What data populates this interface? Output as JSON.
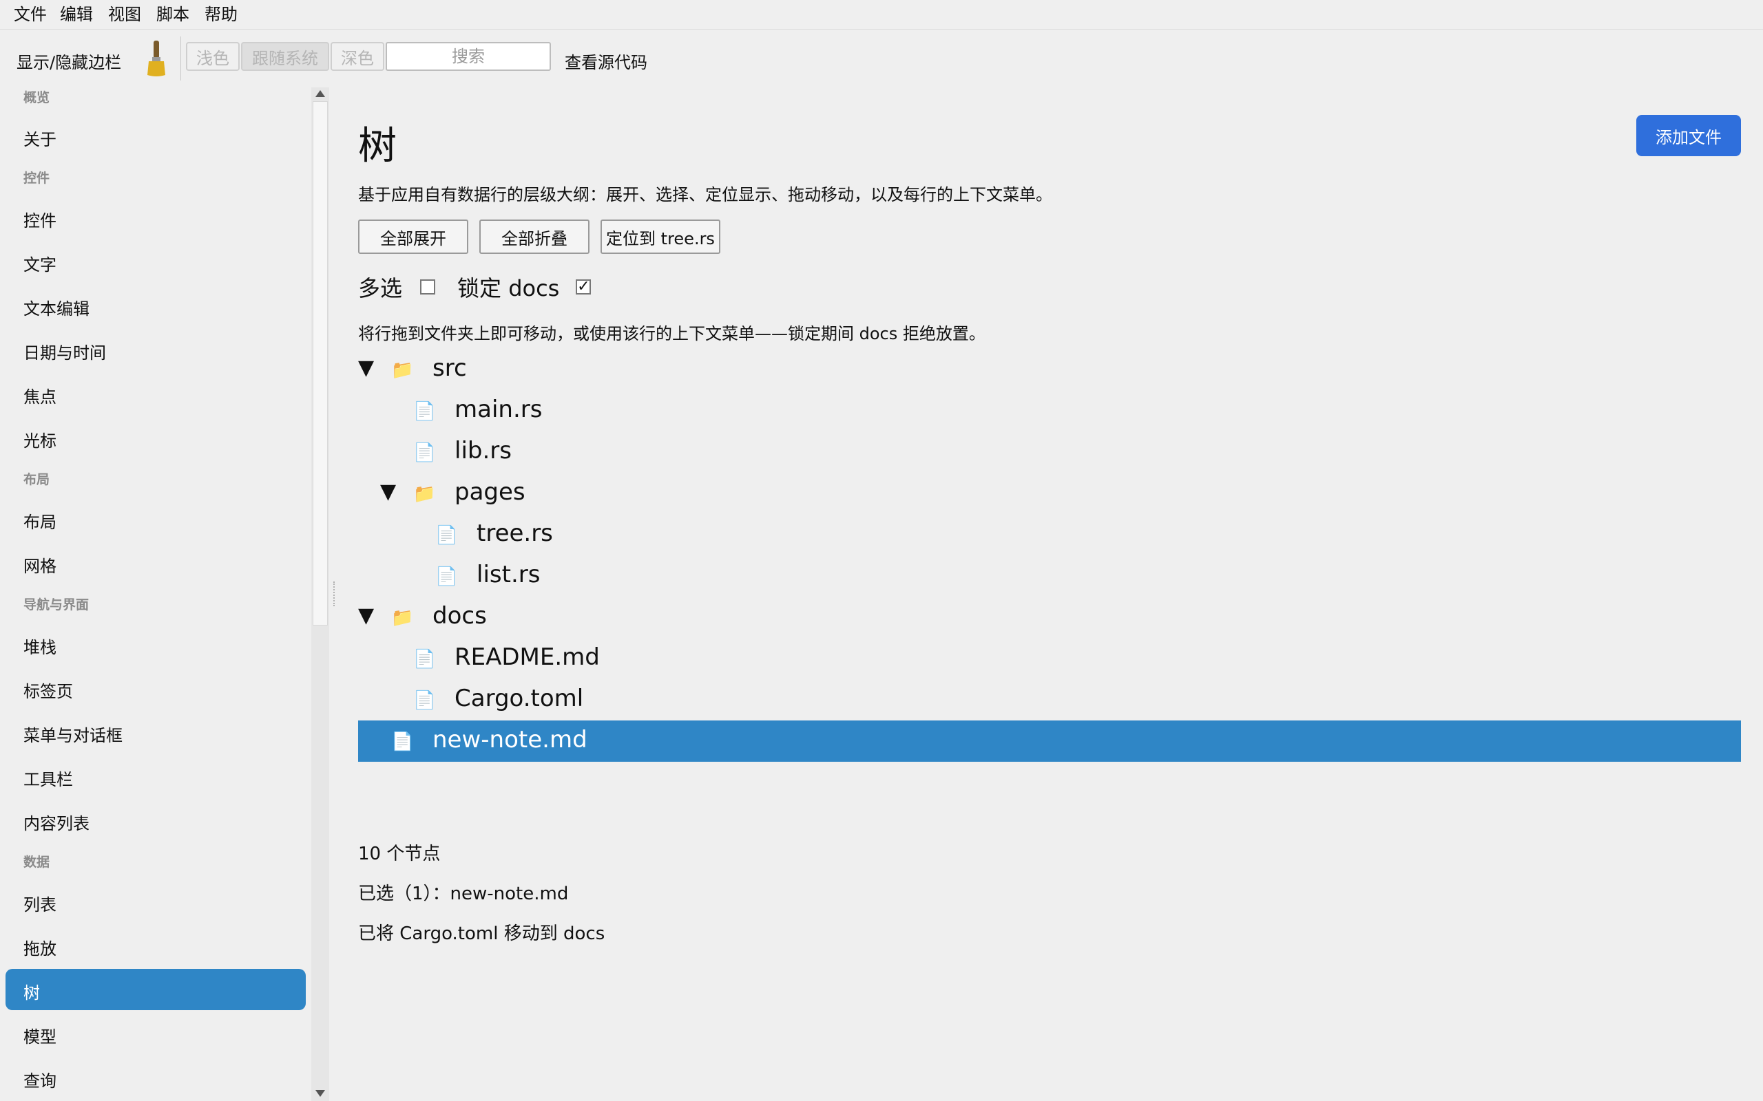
{
  "menubar": {
    "items": [
      "文件",
      "编辑",
      "视图",
      "脚本",
      "帮助"
    ]
  },
  "toolbar": {
    "toggle_sidebar": "显示/隐藏边栏",
    "theme_light": "浅色",
    "theme_system": "跟随系统",
    "theme_dark": "深色",
    "search_placeholder": "搜索",
    "view_source": "查看源代码"
  },
  "sidebar": {
    "sections": [
      {
        "title": "概览",
        "items": [
          "关于"
        ]
      },
      {
        "title": "控件",
        "items": [
          "控件",
          "文字",
          "文本编辑",
          "日期与时间",
          "焦点",
          "光标"
        ]
      },
      {
        "title": "布局",
        "items": [
          "布局",
          "网格"
        ]
      },
      {
        "title": "导航与界面",
        "items": [
          "堆栈",
          "标签页",
          "菜单与对话框",
          "工具栏",
          "内容列表"
        ]
      },
      {
        "title": "数据",
        "items": [
          "列表",
          "拖放",
          "树",
          "模型",
          "查询"
        ]
      }
    ],
    "selected": "树"
  },
  "main": {
    "title": "树",
    "add_file": "添加文件",
    "description": "基于应用自有数据行的层级大纲：展开、选择、定位显示、拖动移动，以及每行的上下文菜单。",
    "buttons": {
      "expand_all": "全部展开",
      "collapse_all": "全部折叠",
      "reveal": "定位到 tree.rs"
    },
    "options": {
      "multi_select": "多选",
      "multi_select_checked": false,
      "lock_docs": "锁定 docs",
      "lock_docs_checked": true,
      "check_mark": "✓"
    },
    "hint": "将行拖到文件夹上即可移动，或使用该行的上下文菜单——锁定期间 docs 拒绝放置。",
    "tree": [
      {
        "label": "src",
        "kind": "folder",
        "depth": 0,
        "expanded": true,
        "twisty": "▼",
        "icon": "📁"
      },
      {
        "label": "main.rs",
        "kind": "file",
        "depth": 1,
        "icon": "📄"
      },
      {
        "label": "lib.rs",
        "kind": "file",
        "depth": 1,
        "icon": "📄"
      },
      {
        "label": "pages",
        "kind": "folder",
        "depth": 1,
        "expanded": true,
        "twisty": "▼",
        "icon": "📁"
      },
      {
        "label": "tree.rs",
        "kind": "file",
        "depth": 2,
        "icon": "📄"
      },
      {
        "label": "list.rs",
        "kind": "file",
        "depth": 2,
        "icon": "📄"
      },
      {
        "label": "docs",
        "kind": "folder",
        "depth": 0,
        "expanded": true,
        "twisty": "▼",
        "icon": "📁"
      },
      {
        "label": "README.md",
        "kind": "file",
        "depth": 1,
        "icon": "📄"
      },
      {
        "label": "Cargo.toml",
        "kind": "file",
        "depth": 1,
        "icon": "📄"
      },
      {
        "label": "new-note.md",
        "kind": "file",
        "depth": 0,
        "selected": true,
        "icon": "📄"
      }
    ],
    "status": {
      "node_count": "10 个节点",
      "selected": "已选（1）：new-note.md",
      "last_action": "已将 Cargo.toml 移动到 docs"
    }
  },
  "colors": {
    "accent": "#2f86c6",
    "primary_button": "#2f6fdc",
    "background": "#efefef"
  }
}
